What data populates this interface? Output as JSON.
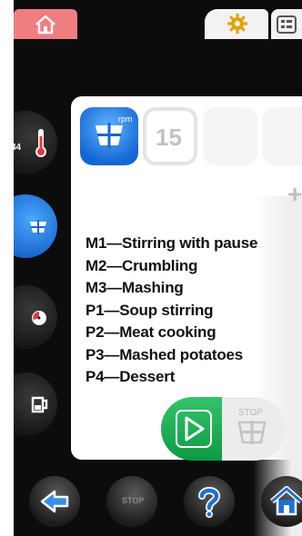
{
  "topbar": {
    "tabs": [
      {
        "icon": "home-icon",
        "active": true
      },
      {
        "icon": "gear-icon",
        "active": false
      },
      {
        "icon": "program-list-icon",
        "active": false
      }
    ]
  },
  "sidebar": {
    "temperature_value": "44",
    "buttons": [
      {
        "icon": "thermometer-icon",
        "active": false
      },
      {
        "icon": "stirring-blade-icon",
        "active": true
      },
      {
        "icon": "timer-icon",
        "active": false
      },
      {
        "icon": "jug-icon",
        "active": false
      }
    ]
  },
  "panel": {
    "rpm_label": "rpm",
    "speed_value": "15",
    "plus_label": "+",
    "programs": [
      "M1—Stirring with pause",
      "M2—Crumbling",
      "M3—Mashing",
      "P1—Soup stirring",
      "P2—Meat cooking",
      "P3—Mashed potatoes",
      "P4—Dessert"
    ],
    "start_icon": "play-icon",
    "stop_label": "STOP"
  },
  "bottombar": {
    "stop_label": "STOP",
    "buttons": [
      "back-arrow-icon",
      "stop-icon",
      "help-icon",
      "home-icon"
    ]
  },
  "colors": {
    "accent_blue": "#1466d4",
    "start_green": "#0e9a44",
    "home_tab": "#f07d80",
    "background": "#0c0c0c"
  }
}
